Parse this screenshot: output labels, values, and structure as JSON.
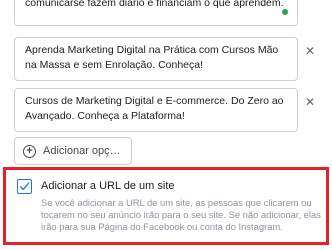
{
  "options": [
    {
      "text": "comunicarse fazem diário e financiam o que aprendem."
    },
    {
      "text": "Aprenda Marketing Digital na Prática com Cursos Mão na Massa e sem Enrolação. Conheça!"
    },
    {
      "text": "Cursos de Marketing Digital e E-commerce. Do Zero ao Avançado. Conheça a Plataforma!"
    }
  ],
  "add_option_label": "Adicionar opç…",
  "url_option": {
    "checked": true,
    "title": "Adicionar a URL de um site",
    "description": "Se você adicionar a URL de um site, as pessoas que clicarem ou tocarem no seu anúncio irão para o seu site. Se não adicionar, elas irão para sua Página do Facebook ou conta do Instagram."
  },
  "colors": {
    "accent": "#1877f2",
    "highlight_border": "#e8202a",
    "status_dot": "#31a24c"
  },
  "icons": {
    "remove": "close-icon",
    "add": "plus-circle-icon",
    "check": "checkmark-icon"
  }
}
